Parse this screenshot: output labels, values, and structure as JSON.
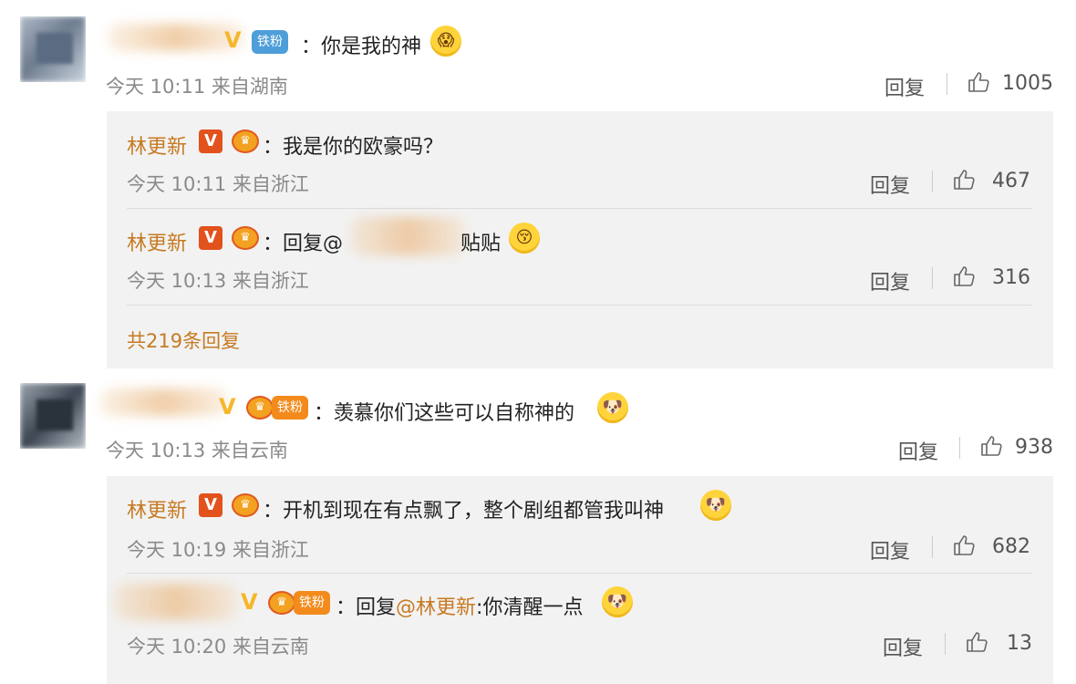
{
  "comments": [
    {
      "text": "：你是我的神",
      "emoji": "scared-emoji",
      "fan_badge": "铁粉",
      "time": "今天 10:11",
      "location": "来自湖南",
      "reply_label": "回复",
      "likes": "1005",
      "replies": [
        {
          "name": "林更新",
          "text": "：我是你的欧豪吗？",
          "time": "今天 10:11",
          "location": "来自浙江",
          "reply_label": "回复",
          "likes": "467"
        },
        {
          "name": "林更新",
          "text_prefix": "：回复@",
          "text_suffix": "贴贴",
          "emoji": "kiss-emoji",
          "time": "今天 10:13",
          "location": "来自浙江",
          "reply_label": "回复",
          "likes": "316"
        }
      ],
      "more_replies": "共219条回复"
    },
    {
      "text": "：羡慕你们这些可以自称神的",
      "emoji": "doge-emoji",
      "fan_badge": "铁粉",
      "time": "今天 10:13",
      "location": "来自云南",
      "reply_label": "回复",
      "likes": "938",
      "replies": [
        {
          "name": "林更新",
          "text": "：开机到现在有点飘了，整个剧组都管我叫神",
          "emoji": "doge-emoji",
          "time": "今天 10:19",
          "location": "来自浙江",
          "reply_label": "回复",
          "likes": "682"
        },
        {
          "fan_badge": "铁粉",
          "text_prefix": "：回复",
          "mention": "@林更新",
          "text_suffix": ":你清醒一点",
          "emoji": "doge-emoji",
          "time": "今天 10:20",
          "location": "来自云南",
          "reply_label": "回复",
          "likes": "13"
        }
      ]
    }
  ],
  "badges": {
    "v_letter": "V"
  }
}
